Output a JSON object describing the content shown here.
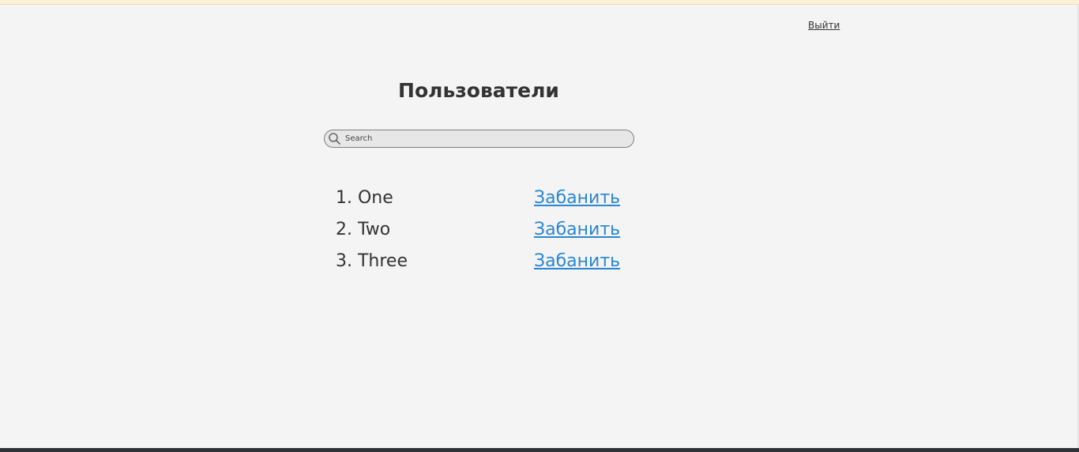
{
  "header": {
    "logout_label": "Выйти"
  },
  "page": {
    "title": "Пользователи"
  },
  "search": {
    "placeholder": "Search",
    "value": ""
  },
  "users": [
    {
      "name": "1. One",
      "action": "Забанить"
    },
    {
      "name": "2. Two",
      "action": "Забанить"
    },
    {
      "name": "3. Three",
      "action": "Забанить"
    }
  ],
  "colors": {
    "background": "#f4f4f4",
    "text": "#333333",
    "link": "#2a86d1",
    "top_strip": "#fdf1d6",
    "search_fill": "#e7e7e7",
    "search_border": "#7f7f7f"
  },
  "icons": {
    "search": "search-icon"
  }
}
